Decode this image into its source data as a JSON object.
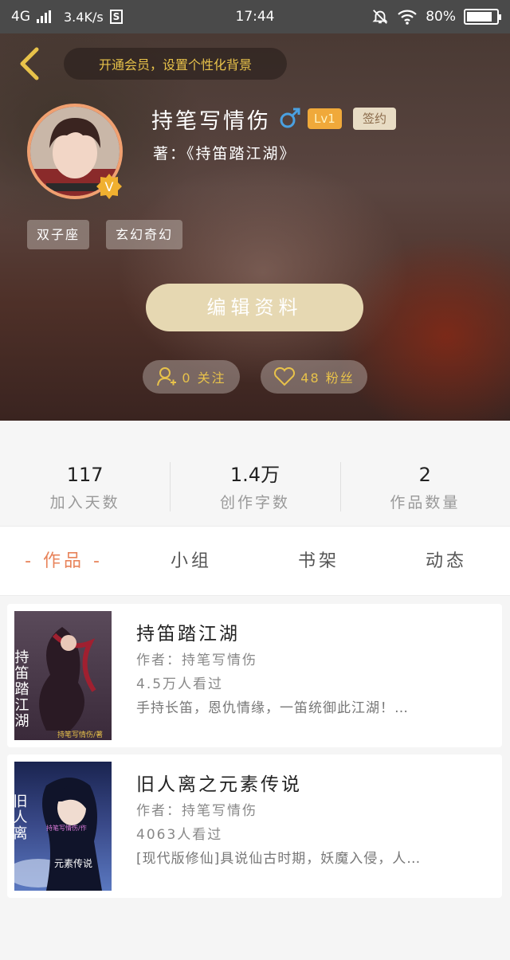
{
  "status_bar": {
    "network": "4G",
    "speed": "3.4K/s",
    "s_badge": "S",
    "time": "17:44",
    "battery": "80%"
  },
  "header": {
    "vip_banner": "开通会员，设置个性化背景",
    "username": "持笔写情伤",
    "level": "Lv1",
    "sign_badge": "签约",
    "works_line": "著：《持笛踏江湖》",
    "tags": [
      "双子座",
      "玄幻奇幻"
    ],
    "edit_button": "编辑资料",
    "follow_label": "0 关注",
    "fans_label": "48 粉丝",
    "v_badge": "V"
  },
  "stats": [
    {
      "value": "117",
      "label": "加入天数"
    },
    {
      "value": "1.4万",
      "label": "创作字数"
    },
    {
      "value": "2",
      "label": "作品数量"
    }
  ],
  "tabs": [
    {
      "label": "- 作品 -",
      "active": true
    },
    {
      "label": "小组",
      "active": false
    },
    {
      "label": "书架",
      "active": false
    },
    {
      "label": "动态",
      "active": false
    }
  ],
  "books": [
    {
      "title": "持笛踏江湖",
      "author": "作者：持笔写情伤",
      "views": "4.5万人看过",
      "description": "手持长笛，恩仇情缘，一笛统御此江湖！…",
      "cover_title": "持笛踏江湖",
      "cover_author": "持笔写情伤/著"
    },
    {
      "title": "旧人离之元素传说",
      "author": "作者：持笔写情伤",
      "views": "4063人看过",
      "description": "[现代版修仙]具说仙古时期，妖魔入侵，人…",
      "cover_title": "旧人离",
      "cover_subtitle": "元素传说",
      "cover_author": "持笔写情伤/作"
    }
  ],
  "colors": {
    "accent": "#e8835a",
    "gold": "#e8c24a",
    "edit_button": "#e6d8b2",
    "level_badge": "#f0a93a"
  }
}
